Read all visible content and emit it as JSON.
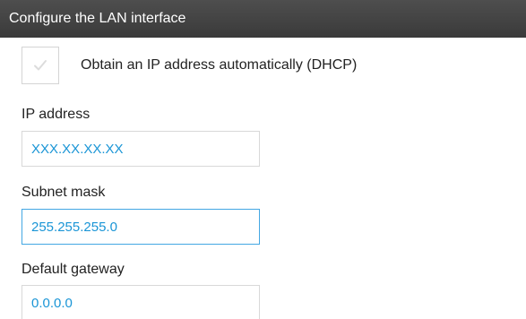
{
  "header": {
    "title": "Configure the LAN interface"
  },
  "dhcp": {
    "label": "Obtain an IP address automatically (DHCP)",
    "checked": false,
    "icon": "checkmark-icon"
  },
  "fields": {
    "ip_address": {
      "label": "IP address",
      "value": "XXX.XX.XX.XX"
    },
    "subnet_mask": {
      "label": "Subnet mask",
      "value": "255.255.255.0"
    },
    "default_gateway": {
      "label": "Default gateway",
      "value": "0.0.0.0"
    }
  },
  "colors": {
    "header_bg": "#434343",
    "input_text": "#1a95d6",
    "focus_border": "#43a7e3"
  }
}
